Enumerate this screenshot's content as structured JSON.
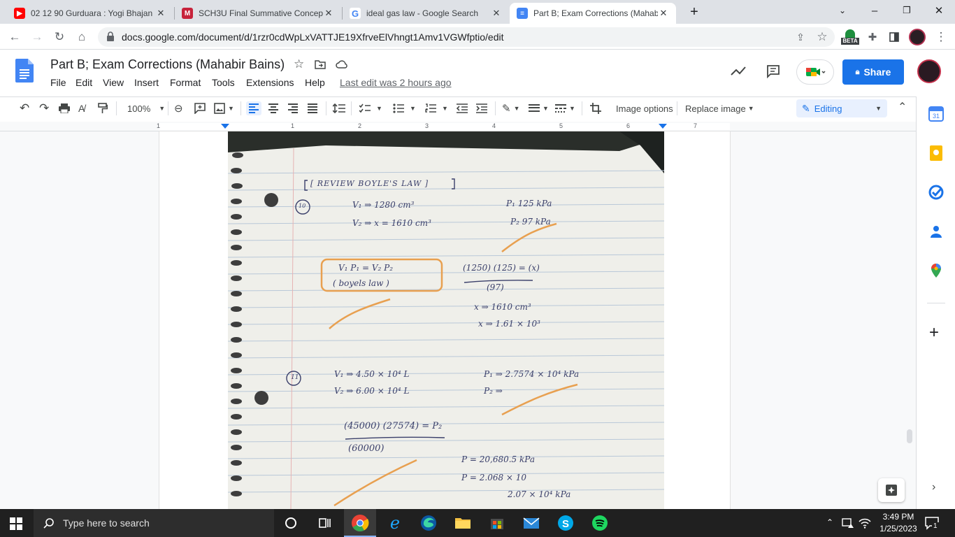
{
  "tabs": [
    {
      "title": "02 12 90 Gurduara : Yogi Bhajan |",
      "icon": "youtube-icon"
    },
    {
      "title": "SCH3U Final Summative Concept",
      "icon": "docs-m-icon"
    },
    {
      "title": "ideal gas law - Google Search",
      "icon": "google-icon"
    },
    {
      "title": "Part B; Exam Corrections (Mahabir",
      "icon": "docs-icon"
    }
  ],
  "address_bar": {
    "url": "docs.google.com/document/d/1rzr0cdWpLxVATTJE19XfrveElVhngt1Amv1VGWfptio/edit",
    "beta_label": "BETA"
  },
  "doc": {
    "title": "Part B; Exam Corrections (Mahabir Bains)",
    "menus": [
      "File",
      "Edit",
      "View",
      "Insert",
      "Format",
      "Tools",
      "Extensions",
      "Help"
    ],
    "last_edit": "Last edit was 2 hours ago",
    "share_label": "Share"
  },
  "toolbar": {
    "zoom": "100%",
    "image_options": "Image options",
    "replace_image": "Replace image",
    "mode": "Editing"
  },
  "ruler": {
    "numbers": [
      "1",
      "1",
      "2",
      "3",
      "4",
      "5",
      "6",
      "7"
    ]
  },
  "notes": {
    "heading": "[ REVIEW  BOYLE'S  LAW ]",
    "q10": {
      "num": "10",
      "v1": "V₁ ⇒ 1280 cm³",
      "v2": "V₂ ⇒ x = 1610 cm³",
      "p1": "P₁  125 kPa",
      "p2": "P₂  97 kPa",
      "formula": "V₁ P₁ = V₂ P₂",
      "formula_note": "( boyels  law )",
      "calc_num": "(1250) (125) = (x)",
      "calc_den": "(97)",
      "res1": "x ⇒ 1610 cm³",
      "res2": "x ⇒ 1.61 × 10³"
    },
    "q11": {
      "num": "11",
      "v1": "V₁ ⇒ 4.50 × 10⁴ L",
      "v2": "V₂ ⇒ 6.00 × 10⁴ L",
      "p1": "P₁ ⇒ 2.7574 × 10⁴ kPa",
      "p2": "P₂ ⇒",
      "calc_num": "(45000) (27574) = P₂",
      "calc_den": "(60000)",
      "res1": "P = 20,680.5 kPa",
      "res2": "P = 2.068 × 10",
      "res3": "2.07 × 10⁴ kPa"
    }
  },
  "taskbar": {
    "search_placeholder": "Type here to search",
    "time": "3:49 PM",
    "date": "1/25/2023",
    "notifications": "1"
  },
  "colors": {
    "accent": "#1a73e8",
    "orange": "#f0a050",
    "pencil": "#3a3f6a"
  }
}
